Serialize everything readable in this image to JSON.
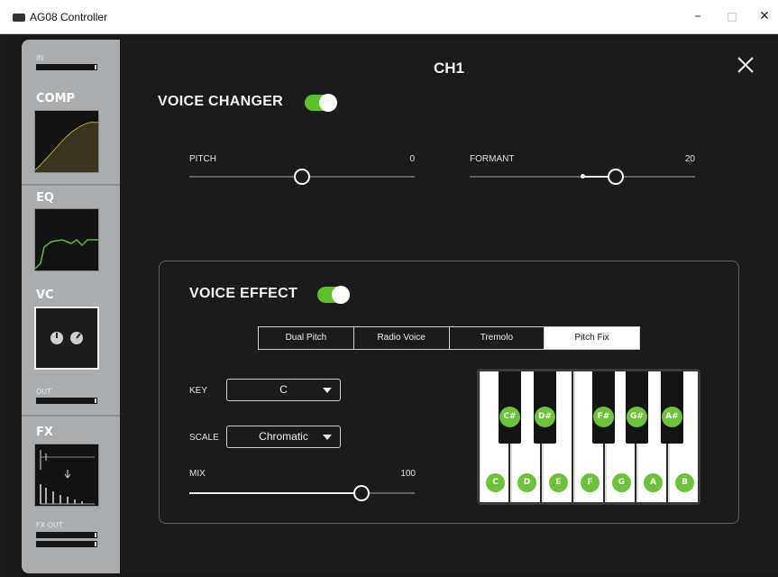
{
  "window": {
    "title": "AG08 Controller",
    "min": "–",
    "max": "□",
    "close": "✕"
  },
  "sidebar": {
    "in_label": "IN",
    "comp_label": "COMP",
    "eq_label": "EQ",
    "vc_label": "VC",
    "out_label": "OUT",
    "fx_label": "FX",
    "fx_out_label": "FX OUT"
  },
  "main": {
    "channel_title": "CH1",
    "voice_changer": {
      "title": "VOICE CHANGER",
      "enabled": true,
      "pitch": {
        "label": "PITCH",
        "value": "0",
        "level": 0.5
      },
      "formant": {
        "label": "FORMANT",
        "value": "20",
        "level": 0.65
      }
    },
    "voice_effect": {
      "title": "VOICE EFFECT",
      "enabled": true,
      "tabs": [
        "Dual Pitch",
        "Radio Voice",
        "Tremolo",
        "Pitch Fix"
      ],
      "active_tab": "Pitch Fix",
      "key": {
        "label": "KEY",
        "value": "C"
      },
      "scale": {
        "label": "SCALE",
        "value": "Chromatic"
      },
      "mix": {
        "label": "MIX",
        "value": "100",
        "level": 0.77
      },
      "keyboard": {
        "white": [
          "C",
          "D",
          "E",
          "F",
          "G",
          "A",
          "B"
        ],
        "black": [
          "C#",
          "D#",
          "F#",
          "G#",
          "A#"
        ]
      }
    }
  },
  "colors": {
    "accent": "#5cc02a",
    "panel": "#1b1b1b",
    "sidebar": "#a9adb0"
  }
}
